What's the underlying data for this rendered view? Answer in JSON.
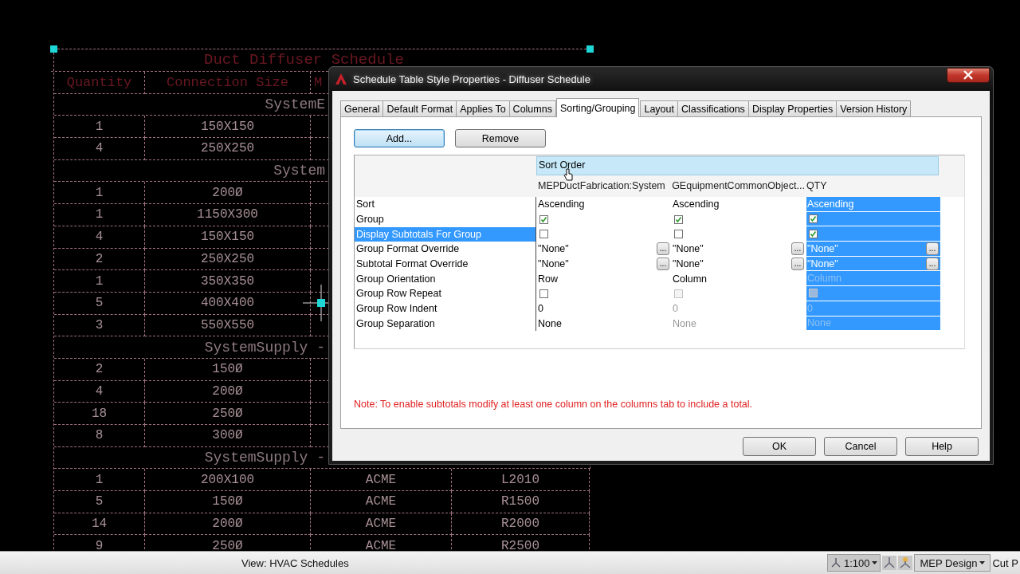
{
  "cad_schedule": {
    "title": "Duct Diffuser Schedule",
    "headers": [
      "Quantity",
      "Connection Size",
      "M"
    ],
    "rows": [
      {
        "kind": "group",
        "label": "SystemE"
      },
      {
        "kind": "item",
        "cells": [
          "1",
          "150X150"
        ]
      },
      {
        "kind": "item",
        "cells": [
          "4",
          "250X250"
        ]
      },
      {
        "kind": "group",
        "label": "System"
      },
      {
        "kind": "item",
        "cells": [
          "1",
          "200Ø"
        ]
      },
      {
        "kind": "item",
        "cells": [
          "1",
          "1150X300"
        ]
      },
      {
        "kind": "item",
        "cells": [
          "4",
          "150X150"
        ]
      },
      {
        "kind": "item",
        "cells": [
          "2",
          "250X250"
        ]
      },
      {
        "kind": "item",
        "cells": [
          "1",
          "350X350"
        ]
      },
      {
        "kind": "item",
        "cells": [
          "5",
          "400X400"
        ]
      },
      {
        "kind": "item",
        "cells": [
          "3",
          "550X550"
        ]
      },
      {
        "kind": "group",
        "label": "SystemSupply -"
      },
      {
        "kind": "item",
        "cells": [
          "2",
          "150Ø"
        ]
      },
      {
        "kind": "item",
        "cells": [
          "4",
          "200Ø"
        ]
      },
      {
        "kind": "item",
        "cells": [
          "18",
          "250Ø"
        ]
      },
      {
        "kind": "item",
        "cells": [
          "8",
          "300Ø"
        ]
      },
      {
        "kind": "group",
        "label": "SystemSupply -"
      },
      {
        "kind": "item",
        "cells": [
          "1",
          "200X100",
          "ACME",
          "L2010"
        ]
      },
      {
        "kind": "item",
        "cells": [
          "5",
          "150Ø",
          "ACME",
          "R1500"
        ]
      },
      {
        "kind": "item",
        "cells": [
          "14",
          "200Ø",
          "ACME",
          "R2000"
        ]
      },
      {
        "kind": "item",
        "cells": [
          "9",
          "250Ø",
          "ACME",
          "R2500"
        ]
      }
    ]
  },
  "dialog": {
    "title": "Schedule Table Style Properties - Diffuser Schedule",
    "tabs": [
      {
        "label": "General",
        "selected": false
      },
      {
        "label": "Default Format",
        "selected": false
      },
      {
        "label": "Applies To",
        "selected": false
      },
      {
        "label": "Columns",
        "selected": false
      },
      {
        "label": "Sorting/Grouping",
        "selected": true
      },
      {
        "label": "Layout",
        "selected": false
      },
      {
        "label": "Classifications",
        "selected": false
      },
      {
        "label": "Display Properties",
        "selected": false
      },
      {
        "label": "Version History",
        "selected": false
      }
    ],
    "actions": [
      {
        "label": "Add...",
        "default": true
      },
      {
        "label": "Remove",
        "default": false
      }
    ],
    "grid": {
      "group_header": "Sort Order",
      "columns": [
        {
          "label": "MEPDuctFabrication:System",
          "selected": false
        },
        {
          "label": "GEquipmentCommonObject...",
          "selected": false
        },
        {
          "label": "QTY",
          "selected": true
        }
      ],
      "rows": [
        {
          "label": "Sort",
          "selected": false,
          "cells": [
            {
              "kind": "text",
              "value": "Ascending",
              "disabled": false
            },
            {
              "kind": "text",
              "value": "Ascending",
              "disabled": false
            },
            {
              "kind": "text",
              "value": "Ascending",
              "disabled": false
            }
          ]
        },
        {
          "label": "Group",
          "selected": false,
          "cells": [
            {
              "kind": "check",
              "checked": true,
              "disabled": false
            },
            {
              "kind": "check",
              "checked": true,
              "disabled": false
            },
            {
              "kind": "check",
              "checked": true,
              "disabled": false
            }
          ]
        },
        {
          "label": "Display Subtotals For Group",
          "selected": true,
          "cells": [
            {
              "kind": "check",
              "checked": false,
              "disabled": false
            },
            {
              "kind": "check",
              "checked": false,
              "disabled": false
            },
            {
              "kind": "check",
              "checked": true,
              "disabled": false
            }
          ]
        },
        {
          "label": "Group Format Override",
          "selected": false,
          "cells": [
            {
              "kind": "override",
              "value": "\"None\"",
              "button": "..."
            },
            {
              "kind": "override",
              "value": "\"None\"",
              "button": "..."
            },
            {
              "kind": "override",
              "value": "\"None\"",
              "button": "..."
            }
          ]
        },
        {
          "label": "Subtotal Format Override",
          "selected": false,
          "cells": [
            {
              "kind": "override",
              "value": "\"None\"",
              "button": "..."
            },
            {
              "kind": "override",
              "value": "\"None\"",
              "button": "..."
            },
            {
              "kind": "override",
              "value": "\"None\"",
              "button": "..."
            }
          ]
        },
        {
          "label": "Group Orientation",
          "selected": false,
          "cells": [
            {
              "kind": "text",
              "value": "Row",
              "disabled": false
            },
            {
              "kind": "text",
              "value": "Column",
              "disabled": false
            },
            {
              "kind": "text",
              "value": "Column",
              "disabled": true
            }
          ]
        },
        {
          "label": "Group Row Repeat",
          "selected": false,
          "cells": [
            {
              "kind": "check",
              "checked": false,
              "disabled": false
            },
            {
              "kind": "check",
              "checked": false,
              "disabled": true
            },
            {
              "kind": "check",
              "checked": false,
              "disabled": true
            }
          ]
        },
        {
          "label": "Group Row Indent",
          "selected": false,
          "cells": [
            {
              "kind": "text",
              "value": "0",
              "disabled": false
            },
            {
              "kind": "text",
              "value": "0",
              "disabled": true
            },
            {
              "kind": "text",
              "value": "0",
              "disabled": true
            }
          ]
        },
        {
          "label": "Group Separation",
          "selected": false,
          "cells": [
            {
              "kind": "text",
              "value": "None",
              "disabled": false
            },
            {
              "kind": "text",
              "value": "None",
              "disabled": true
            },
            {
              "kind": "text",
              "value": "None",
              "disabled": true
            }
          ]
        }
      ]
    },
    "note": "Note: To enable subtotals modify at least one column on the columns tab to include a total.",
    "buttons": [
      "OK",
      "Cancel",
      "Help"
    ]
  },
  "status_bar": {
    "view": "View: HVAC Schedules",
    "scale": "1:100",
    "workspace": "MEP Design",
    "cut_plane": "Cut P"
  }
}
